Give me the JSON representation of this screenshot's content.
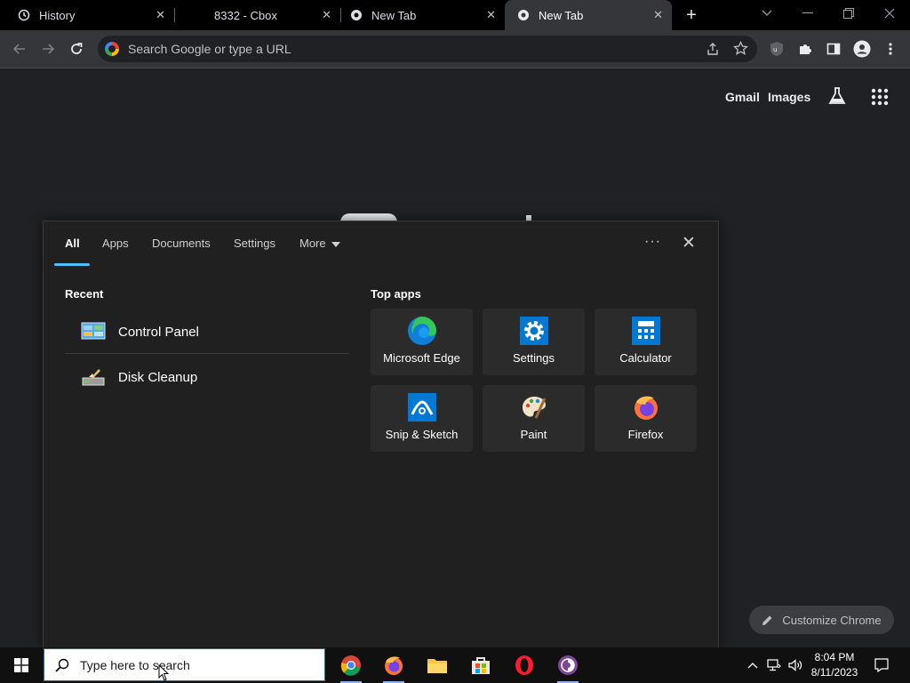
{
  "browser": {
    "tabs": [
      {
        "title": "History",
        "active": false
      },
      {
        "title": "8332 - Cbox",
        "active": false
      },
      {
        "title": "New Tab",
        "active": false
      },
      {
        "title": "New Tab",
        "active": true
      }
    ],
    "omnibox_placeholder": "Search Google or type a URL"
  },
  "newtab": {
    "gmail": "Gmail",
    "images": "Images",
    "customize": "Customize Chrome"
  },
  "search_panel": {
    "tabs": [
      "All",
      "Apps",
      "Documents",
      "Settings",
      "More"
    ],
    "recent_title": "Recent",
    "recent": [
      {
        "label": "Control Panel",
        "icon": "control-panel-icon"
      },
      {
        "label": "Disk Cleanup",
        "icon": "disk-cleanup-icon"
      }
    ],
    "top_apps_title": "Top apps",
    "top_apps": [
      {
        "label": "Microsoft Edge",
        "icon": "edge-icon"
      },
      {
        "label": "Settings",
        "icon": "settings-gear-icon"
      },
      {
        "label": "Calculator",
        "icon": "calculator-icon"
      },
      {
        "label": "Snip & Sketch",
        "icon": "snip-sketch-icon"
      },
      {
        "label": "Paint",
        "icon": "paint-palette-icon"
      },
      {
        "label": "Firefox",
        "icon": "firefox-icon"
      }
    ]
  },
  "taskbar": {
    "search_placeholder": "Type here to search",
    "time": "8:04 PM",
    "date": "8/11/2023"
  },
  "colors": {
    "accent": "#4cc2ff",
    "panel_bg": "#202020",
    "page_bg": "#202124"
  }
}
